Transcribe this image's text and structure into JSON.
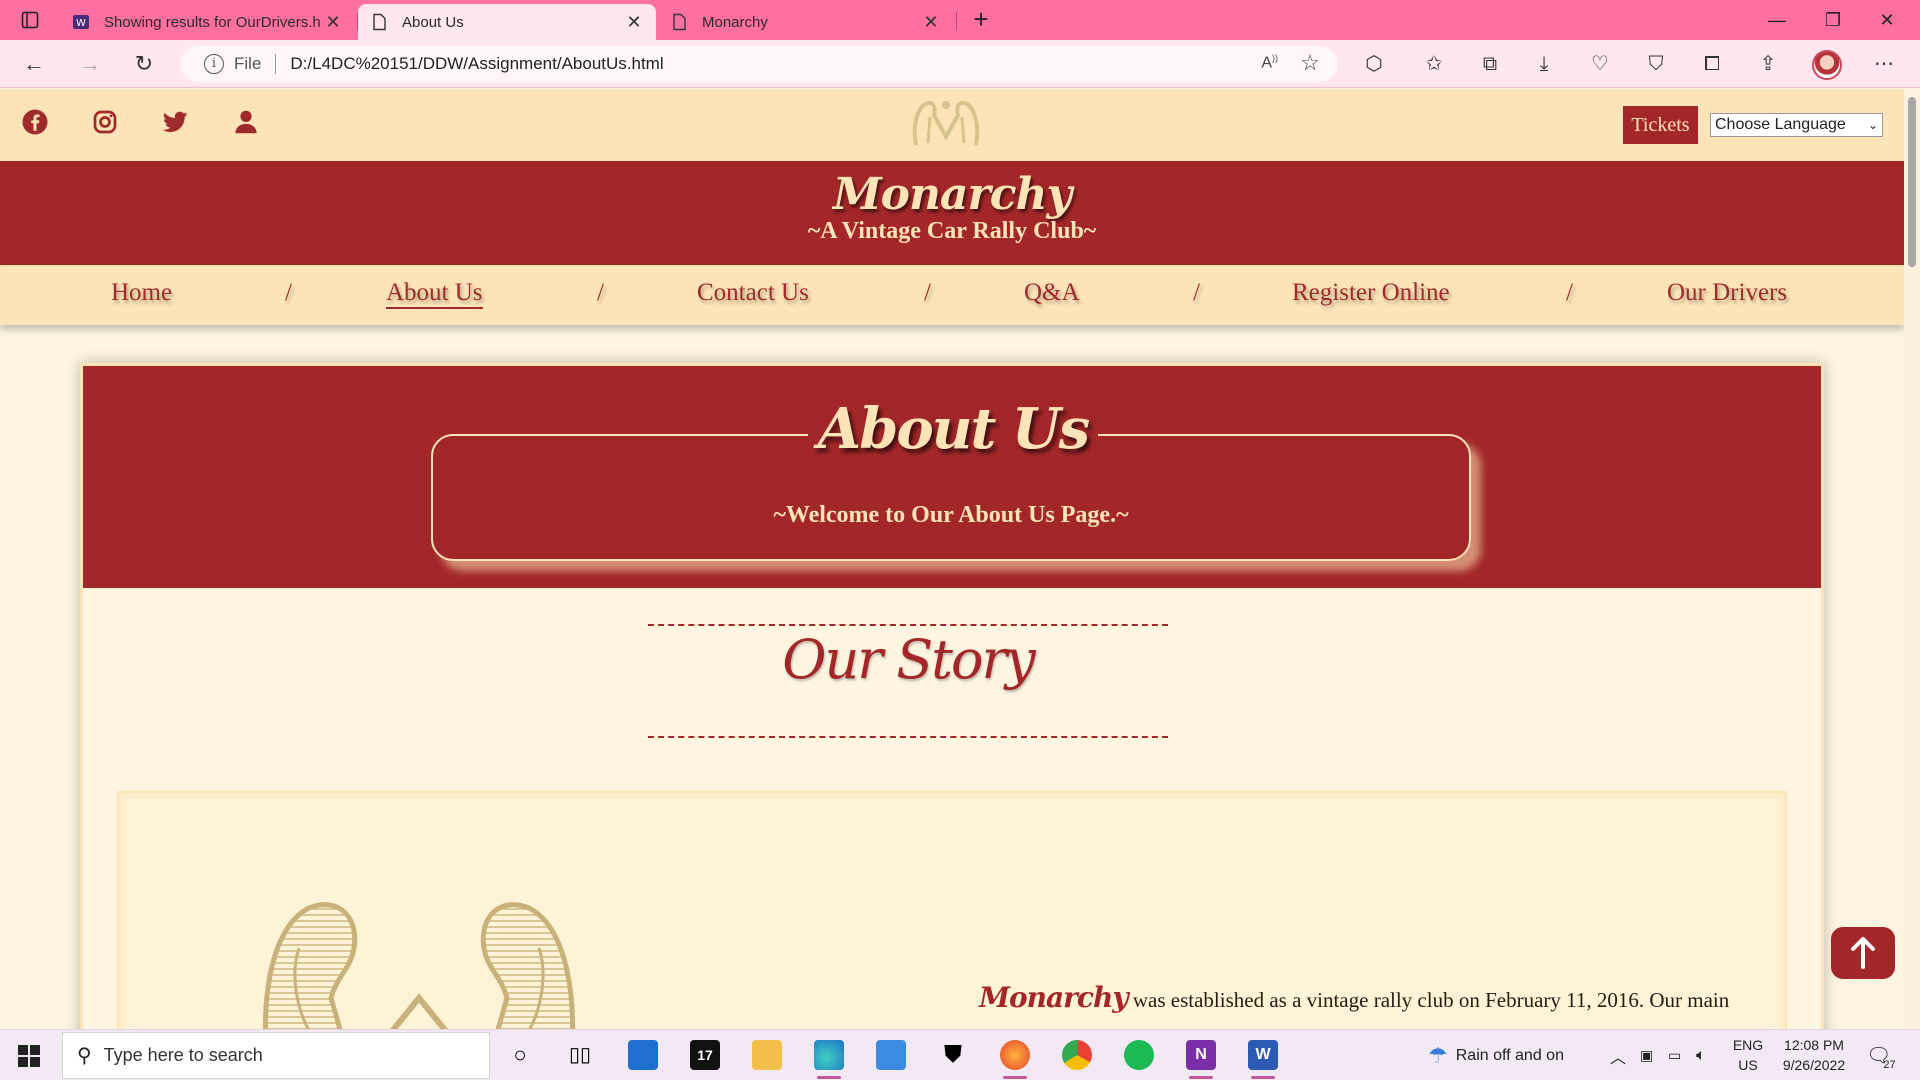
{
  "browser": {
    "tabs": [
      {
        "title": "Showing results for OurDrivers.h"
      },
      {
        "title": "About Us"
      },
      {
        "title": "Monarchy"
      }
    ],
    "address": {
      "scheme_label": "File",
      "url": "D:/L4DC%20151/DDW/Assignment/AboutUs.html"
    }
  },
  "site": {
    "tickets_label": "Tickets",
    "language_select": "Choose Language",
    "brand": "Monarchy",
    "tagline": "~A Vintage Car Rally Club~",
    "nav": [
      {
        "label": "Home"
      },
      {
        "label": "About Us",
        "active": true
      },
      {
        "label": "Contact Us"
      },
      {
        "label": "Q&A"
      },
      {
        "label": "Register Online"
      },
      {
        "label": "Our Drivers"
      }
    ],
    "nav_separator": "/",
    "colors": {
      "primary": "#a32729",
      "cream": "#fde4b8",
      "background": "#fdf5e0"
    }
  },
  "hero": {
    "title": "About Us",
    "subtitle": "~Welcome to Our About Us Page.~"
  },
  "story": {
    "heading": "Our Story",
    "brand_inline": "Monarchy",
    "text": " was established as a vintage rally club on February 11, 2016. Our main"
  },
  "taskbar": {
    "search_placeholder": "Type here to search",
    "weather": "Rain off and on",
    "lang_line1": "ENG",
    "lang_line2": "US",
    "time": "12:08 PM",
    "date": "9/26/2022",
    "notifications": "27"
  }
}
